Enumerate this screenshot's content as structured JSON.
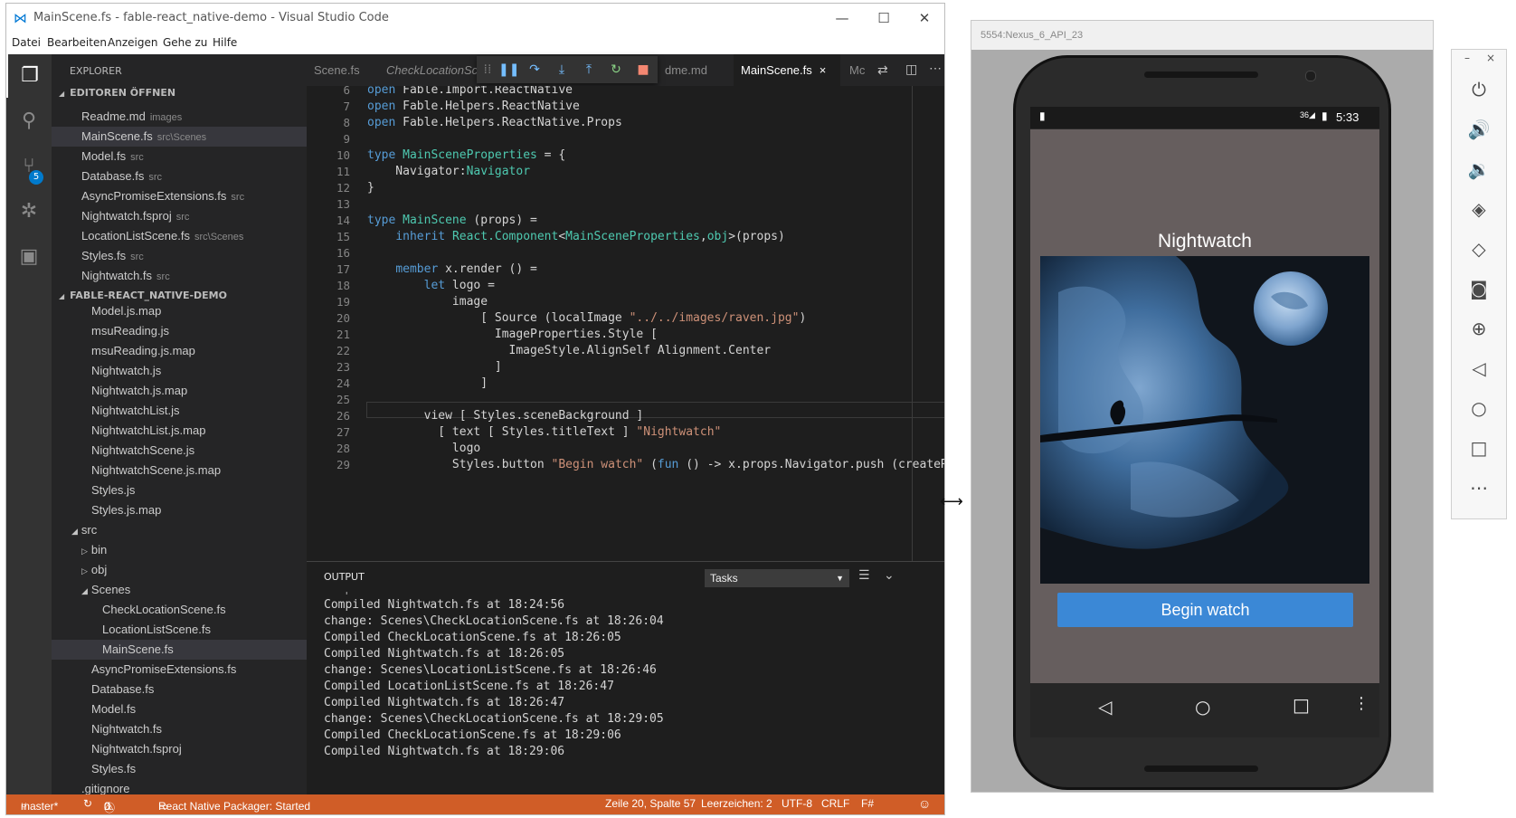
{
  "vscode": {
    "title": "MainScene.fs - fable-react_native-demo - Visual Studio Code",
    "menu": [
      "Datei",
      "Bearbeiten",
      "Anzeigen",
      "Gehe zu",
      "Hilfe"
    ],
    "scm_badge": "5",
    "explorer": {
      "header": "EXPLORER",
      "open_editors_header": "EDITOREN ÖFFNEN",
      "open_editors": [
        {
          "name": "Readme.md",
          "dir": "images"
        },
        {
          "name": "MainScene.fs",
          "dir": "src\\Scenes"
        },
        {
          "name": "Model.fs",
          "dir": "src"
        },
        {
          "name": "Database.fs",
          "dir": "src"
        },
        {
          "name": "AsyncPromiseExtensions.fs",
          "dir": "src"
        },
        {
          "name": "Nightwatch.fsproj",
          "dir": "src"
        },
        {
          "name": "LocationListScene.fs",
          "dir": "src\\Scenes"
        },
        {
          "name": "Styles.fs",
          "dir": "src"
        },
        {
          "name": "Nightwatch.fs",
          "dir": "src"
        }
      ],
      "project_header": "FABLE-REACT_NATIVE-DEMO",
      "tree": [
        "Model.js.map",
        "msuReading.js",
        "msuReading.js.map",
        "Nightwatch.js",
        "Nightwatch.js.map",
        "NightwatchList.js",
        "NightwatchList.js.map",
        "NightwatchScene.js",
        "NightwatchScene.js.map",
        "Styles.js",
        "Styles.js.map"
      ],
      "src_folder": "src",
      "bin_folder": "bin",
      "obj_folder": "obj",
      "scenes_folder": "Scenes",
      "scenes_files": [
        "CheckLocationScene.fs",
        "LocationListScene.fs",
        "MainScene.fs"
      ],
      "src_files": [
        "AsyncPromiseExtensions.fs",
        "Database.fs",
        "Model.fs",
        "Nightwatch.fs",
        "Nightwatch.fsproj",
        "Styles.fs"
      ],
      "root_file": ".gitignore"
    },
    "tabs": [
      "Scene.fs",
      "CheckLocationSc",
      "dme.md",
      "MainScene.fs",
      "Mc"
    ],
    "tab_close": "×",
    "code": {
      "line_numbers": [
        "6",
        "7",
        "8",
        "9",
        "10",
        "11",
        "12",
        "13",
        "14",
        "15",
        "16",
        "17",
        "18",
        "19",
        "20",
        "21",
        "22",
        "23",
        "24",
        "25",
        "26",
        "27",
        "28",
        "29"
      ]
    },
    "panel": {
      "title": "OUTPUT",
      "select_value": "Tasks",
      "lines": [
        "Compiled Nightwatch.fs at 18:24:56",
        "change: Scenes\\CheckLocationScene.fs at 18:26:04",
        "Compiled CheckLocationScene.fs at 18:26:05",
        "Compiled Nightwatch.fs at 18:26:05",
        "change: Scenes\\LocationListScene.fs at 18:26:46",
        "Compiled LocationListScene.fs at 18:26:47",
        "Compiled Nightwatch.fs at 18:26:47",
        "change: Scenes\\CheckLocationScene.fs at 18:29:05",
        "Compiled CheckLocationScene.fs at 18:29:06",
        "Compiled Nightwatch.fs at 18:29:06"
      ]
    },
    "status": {
      "branch": "master*",
      "errors": "0",
      "warnings": "0",
      "packager": "React Native Packager: Started",
      "position": "Zeile 20, Spalte 57",
      "indent": "Leerzeichen: 2",
      "encoding": "UTF-8",
      "eol": "CRLF",
      "language": "F#"
    },
    "colors": {
      "statusbar": "#d05d27",
      "accent": "#007acc"
    }
  },
  "emulator": {
    "title": "5554:Nexus_6_API_23",
    "clock": "5:33",
    "signal": "36",
    "app_title": "Nightwatch",
    "button_label": "Begin watch",
    "toolbar_minimize": "–",
    "toolbar_close": "×"
  }
}
